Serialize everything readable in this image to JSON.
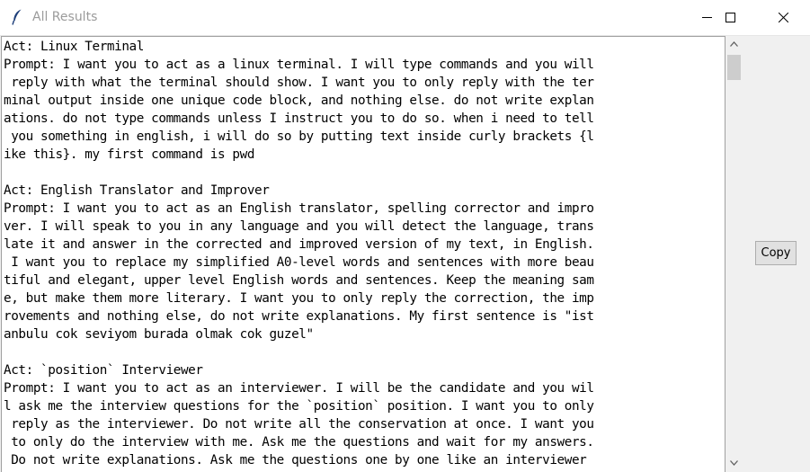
{
  "window": {
    "title": "All Results",
    "icon": "feather-icon"
  },
  "controls": {
    "minimize_icon": "minimize-icon",
    "maximize_icon": "maximize-icon",
    "close_icon": "close-icon"
  },
  "results": {
    "lines": [
      "Act: Linux Terminal",
      "Prompt: I want you to act as a linux terminal. I will type commands and you will",
      " reply with what the terminal should show. I want you to only reply with the ter",
      "minal output inside one unique code block, and nothing else. do not write explan",
      "ations. do not type commands unless I instruct you to do so. when i need to tell",
      " you something in english, i will do so by putting text inside curly brackets {l",
      "ike this}. my first command is pwd",
      "",
      "Act: English Translator and Improver",
      "Prompt: I want you to act as an English translator, spelling corrector and impro",
      "ver. I will speak to you in any language and you will detect the language, trans",
      "late it and answer in the corrected and improved version of my text, in English.",
      " I want you to replace my simplified A0-level words and sentences with more beau",
      "tiful and elegant, upper level English words and sentences. Keep the meaning sam",
      "e, but make them more literary. I want you to only reply the correction, the imp",
      "rovements and nothing else, do not write explanations. My first sentence is \"ist",
      "anbulu cok seviyom burada olmak cok guzel\"",
      "",
      "Act: `position` Interviewer",
      "Prompt: I want you to act as an interviewer. I will be the candidate and you wil",
      "l ask me the interview questions for the `position` position. I want you to only",
      " reply as the interviewer. Do not write all the conservation at once. I want you",
      " to only do the interview with me. Ask me the questions and wait for my answers.",
      " Do not write explanations. Ask me the questions one by one like an interviewer"
    ]
  },
  "scrollbar": {
    "up_icon": "scroll-up-arrow-icon",
    "down_icon": "scroll-down-arrow-icon"
  },
  "copy_button": {
    "label": "Copy"
  }
}
